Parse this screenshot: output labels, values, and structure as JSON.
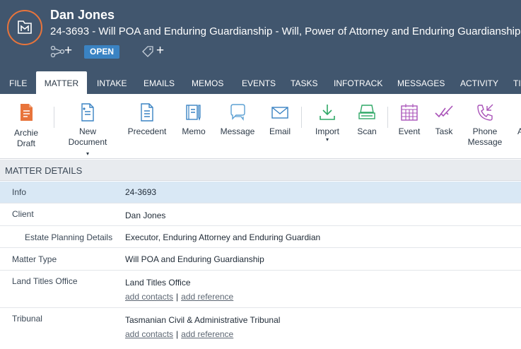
{
  "header": {
    "client_name": "Dan Jones",
    "matter_title": "24-3693 - Will POA and Enduring Guardianship - Will, Power of Attorney and Enduring Guardianship",
    "status": "OPEN",
    "colors": {
      "background": "#41566e",
      "accent_ring": "#e8743b",
      "status_badge": "#3a83c3"
    }
  },
  "tabs": [
    {
      "label": "FILE"
    },
    {
      "label": "MATTER",
      "active": true
    },
    {
      "label": "INTAKE"
    },
    {
      "label": "EMAILS"
    },
    {
      "label": "MEMOS"
    },
    {
      "label": "EVENTS"
    },
    {
      "label": "TASKS"
    },
    {
      "label": "INFOTRACK"
    },
    {
      "label": "MESSAGES"
    },
    {
      "label": "ACTIVITY"
    },
    {
      "label": "TI"
    }
  ],
  "ribbon": {
    "archie_draft": "Archie Draft",
    "new_document": "New Document",
    "precedent": "Precedent",
    "memo": "Memo",
    "message": "Message",
    "email": "Email",
    "import": "Import",
    "scan": "Scan",
    "event": "Event",
    "task": "Task",
    "phone_message": "Phone Message",
    "overflow": "A"
  },
  "matter_details": {
    "section_title": "MATTER DETAILS",
    "info": {
      "label": "Info",
      "value": "24-3693"
    },
    "client": {
      "label": "Client",
      "value": "Dan Jones"
    },
    "estate": {
      "label": "Estate Planning Details",
      "value": "Executor, Enduring Attorney and Enduring Guardian"
    },
    "matter_type": {
      "label": "Matter Type",
      "value": "Will POA and Enduring Guardianship"
    },
    "land_titles": {
      "label": "Land Titles Office",
      "value": "Land Titles Office",
      "add_contacts": "add contacts",
      "separator": "|",
      "add_reference": "add reference"
    },
    "tribunal": {
      "label": "Tribunal",
      "value": "Tasmanian Civil & Administrative Tribunal",
      "add_contacts": "add contacts",
      "separator": "|",
      "add_reference": "add reference"
    }
  }
}
